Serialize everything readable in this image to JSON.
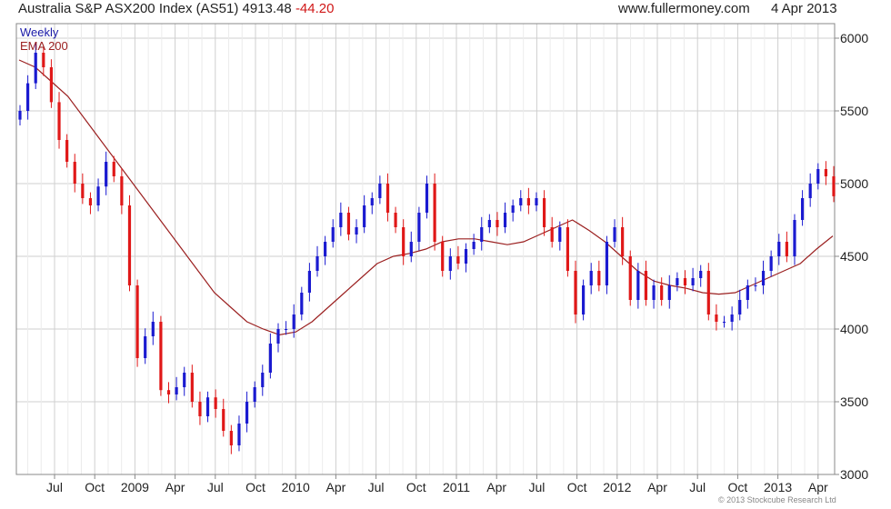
{
  "header": {
    "title": "Australia S&P ASX200 Index (AS51) 4913.48",
    "change": "-44.20",
    "site": "www.fullermoney.com",
    "date": "4 Apr 2013"
  },
  "legend": {
    "weekly": "Weekly",
    "ema": "EMA 200"
  },
  "copyright": "© 2013 Stockcube Research Ltd",
  "colors": {
    "up": "#1a1ad0",
    "down": "#e01818",
    "ema": "#9b2020",
    "grid": "#cfcfcf"
  },
  "chart_data": {
    "type": "candlestick",
    "title": "Australia S&P ASX200 Index (AS51) 4913.48",
    "y_axis_side": "right",
    "ylim": [
      3000,
      6100
    ],
    "yticks": [
      3000,
      3500,
      4000,
      4500,
      5000,
      5500,
      6000
    ],
    "x_tick_labels": [
      "Jul",
      "Oct",
      "2009",
      "Apr",
      "Jul",
      "Oct",
      "2010",
      "Apr",
      "Jul",
      "Oct",
      "2011",
      "Apr",
      "Jul",
      "Oct",
      "2012",
      "Apr",
      "Jul",
      "Oct",
      "2013",
      "Apr"
    ],
    "series": [
      {
        "name": "Weekly",
        "style": "candles",
        "close": [
          5500,
          5690,
          5900,
          5800,
          5560,
          5300,
          5150,
          5000,
          4900,
          4850,
          4980,
          5150,
          5050,
          4850,
          4300,
          3800,
          3950,
          4050,
          3580,
          3550,
          3600,
          3700,
          3500,
          3400,
          3530,
          3450,
          3300,
          3200,
          3350,
          3500,
          3600,
          3700,
          3900,
          4000,
          4000,
          4100,
          4250,
          4400,
          4500,
          4600,
          4700,
          4800,
          4650,
          4700,
          4850,
          4900,
          5000,
          4800,
          4700,
          4500,
          4600,
          4800,
          5000,
          4600,
          4400,
          4500,
          4450,
          4550,
          4600,
          4700,
          4750,
          4700,
          4800,
          4850,
          4900,
          4850,
          4900,
          4700,
          4600,
          4700,
          4400,
          4100,
          4300,
          4400,
          4300,
          4600,
          4700,
          4500,
          4200,
          4400,
          4200,
          4300,
          4200,
          4300,
          4350,
          4300,
          4350,
          4400,
          4100,
          4050,
          4050,
          4100,
          4200,
          4300,
          4300,
          4400,
          4500,
          4600,
          4500,
          4750,
          4900,
          5000,
          5100,
          5050,
          4913
        ]
      },
      {
        "name": "EMA 200",
        "style": "line",
        "values": [
          5850,
          5800,
          5700,
          5600,
          5450,
          5300,
          5150,
          5000,
          4850,
          4700,
          4550,
          4400,
          4250,
          4150,
          4050,
          4000,
          3960,
          3980,
          4050,
          4150,
          4250,
          4350,
          4450,
          4500,
          4520,
          4550,
          4600,
          4620,
          4620,
          4600,
          4580,
          4600,
          4650,
          4700,
          4750,
          4680,
          4600,
          4500,
          4400,
          4330,
          4300,
          4280,
          4250,
          4240,
          4250,
          4300,
          4350,
          4400,
          4450,
          4550,
          4640
        ]
      }
    ]
  }
}
